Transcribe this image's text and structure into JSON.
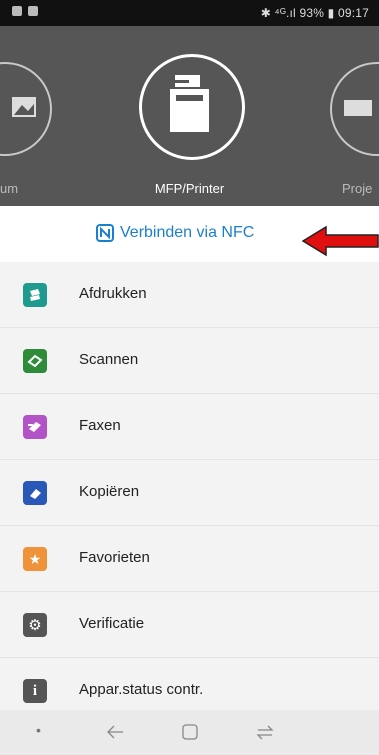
{
  "status_bar": {
    "right_text": "⛰ ὏6 .ıl 93% ▮ 09:17",
    "battery": "93%",
    "time": "09:17"
  },
  "devices": {
    "left_label": "um",
    "center_label": "MFP/Printer",
    "right_label": "Proje"
  },
  "nfc": {
    "label": "Verbinden via NFC"
  },
  "menu": [
    {
      "label": "Afdrukken",
      "color": "#1e9a8f"
    },
    {
      "label": "Scannen",
      "color": "#2e8b3a"
    },
    {
      "label": "Faxen",
      "color": "#b253c7"
    },
    {
      "label": "Kopiëren",
      "color": "#2958b8"
    },
    {
      "label": "Favorieten",
      "color": "#f0923a"
    },
    {
      "label": "Verificatie",
      "color": "#555555"
    },
    {
      "label": "Appar.status contr.",
      "color": "#555555"
    }
  ],
  "colors": {
    "header_bg": "#565656",
    "nfc_blue": "#1a7fcf",
    "arrow_red": "#e01010"
  }
}
